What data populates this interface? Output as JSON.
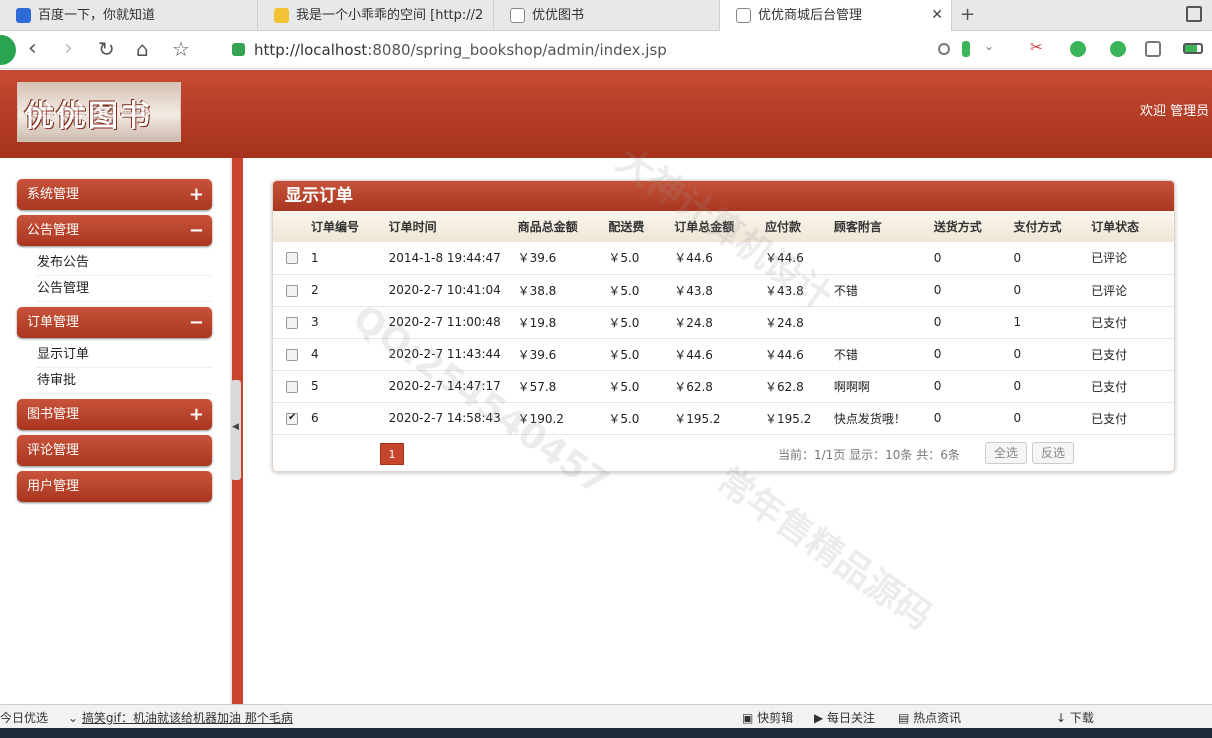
{
  "browser": {
    "tabs": [
      {
        "label": "百度一下，你就知道",
        "icon": "paw-icon"
      },
      {
        "label": "我是一个小乖乖的空间 [http://2",
        "icon": "star-icon"
      },
      {
        "label": "优优图书",
        "icon": "page-icon"
      },
      {
        "label": "优优商城后台管理",
        "icon": "page-icon",
        "active": true
      }
    ],
    "url_host": "http://localhost",
    "url_path": ":8080/spring_bookshop/admin/index.jsp"
  },
  "header": {
    "logo_text": "优优图书",
    "welcome": "欢迎  管理员"
  },
  "sidebar": {
    "menus": [
      {
        "label": "系统管理",
        "sign": "+"
      },
      {
        "label": "公告管理",
        "sign": "−",
        "items": [
          "发布公告",
          "公告管理"
        ]
      },
      {
        "label": "订单管理",
        "sign": "−",
        "items": [
          "显示订单",
          "待审批"
        ]
      },
      {
        "label": "图书管理",
        "sign": "+"
      },
      {
        "label": "评论管理"
      },
      {
        "label": "用户管理"
      }
    ]
  },
  "panel": {
    "title": "显示订单",
    "columns": [
      "订单编号",
      "订单时间",
      "商品总金额",
      "配送费",
      "订单总金额",
      "应付款",
      "顾客附言",
      "送货方式",
      "支付方式",
      "订单状态"
    ],
    "rows": [
      {
        "checked": false,
        "cells": [
          "1",
          "2014-1-8 19:44:47",
          "￥39.6",
          "￥5.0",
          "￥44.6",
          "￥44.6",
          "",
          "0",
          "0",
          "已评论"
        ]
      },
      {
        "checked": false,
        "cells": [
          "2",
          "2020-2-7 10:41:04",
          "￥38.8",
          "￥5.0",
          "￥43.8",
          "￥43.8",
          "不错",
          "0",
          "0",
          "已评论"
        ]
      },
      {
        "checked": false,
        "cells": [
          "3",
          "2020-2-7 11:00:48",
          "￥19.8",
          "￥5.0",
          "￥24.8",
          "￥24.8",
          "",
          "0",
          "1",
          "已支付"
        ]
      },
      {
        "checked": false,
        "cells": [
          "4",
          "2020-2-7 11:43:44",
          "￥39.6",
          "￥5.0",
          "￥44.6",
          "￥44.6",
          "不错",
          "0",
          "0",
          "已支付"
        ]
      },
      {
        "checked": false,
        "cells": [
          "5",
          "2020-2-7 14:47:17",
          "￥57.8",
          "￥5.0",
          "￥62.8",
          "￥62.8",
          "啊啊啊",
          "0",
          "0",
          "已支付"
        ]
      },
      {
        "checked": true,
        "cells": [
          "6",
          "2020-2-7 14:58:43",
          "￥190.2",
          "￥5.0",
          "￥195.2",
          "￥195.2",
          "快点发货哦！",
          "0",
          "0",
          "已支付"
        ]
      }
    ],
    "pager": {
      "current_page": "1",
      "info": "当前：1/1页  显示：10条  共：6条",
      "select_all": "全选",
      "invert": "反选"
    }
  },
  "statusbar": {
    "left": "今日优选",
    "news": "搞笑gif：机油就该给机器加油 那个毛病",
    "items": [
      "快剪辑",
      "每日关注",
      "热点资讯",
      "下载"
    ]
  },
  "watermark": [
    "大神计算机设计",
    "QQ:254540457",
    "常年售精品源码"
  ]
}
